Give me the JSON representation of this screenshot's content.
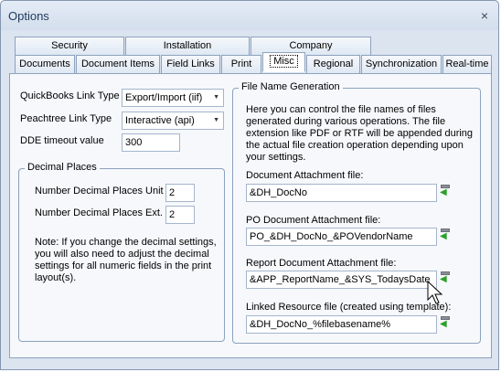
{
  "window": {
    "title": "Options",
    "close_glyph": "×"
  },
  "tabs_row1": [
    {
      "label": "Security"
    },
    {
      "label": "Installation"
    },
    {
      "label": "Company"
    }
  ],
  "tabs_row2": [
    {
      "label": "Documents"
    },
    {
      "label": "Document Items"
    },
    {
      "label": "Field Links"
    },
    {
      "label": "Print"
    },
    {
      "label": "Misc",
      "active": true
    },
    {
      "label": "Regional"
    },
    {
      "label": "Synchronization"
    },
    {
      "label": "Real-time"
    }
  ],
  "links": {
    "quickbooks_label": "QuickBooks Link Type",
    "quickbooks_value": "Export/Import (iif)",
    "peachtree_label": "Peachtree Link Type",
    "peachtree_value": "Interactive (api)",
    "dde_label": "DDE timeout value",
    "dde_value": "300"
  },
  "decimal": {
    "title": "Decimal Places",
    "unit_label": "Number Decimal Places Unit",
    "unit_value": "2",
    "ext_label": "Number Decimal Places Ext.",
    "ext_value": "2",
    "note_lines": [
      "Note: If you change the decimal settings,",
      "you will also need to adjust the decimal",
      "settings for all numeric fields in the print",
      "layout(s)."
    ]
  },
  "file_gen": {
    "title": "File Name Generation",
    "desc_lines": [
      "Here you can control the file names of files",
      "generated during various operations. The file",
      "extension like PDF or RTF will be appended during",
      "the actual file creation operation depending upon",
      "your settings."
    ],
    "doc_label": "Document Attachment file:",
    "doc_value": "&DH_DocNo",
    "po_label": "PO Document Attachment file:",
    "po_value": "PO_&DH_DocNo_&POVendorName",
    "report_label": "Report Document Attachment file:",
    "report_value": "&APP_ReportName_&SYS_TodaysDate",
    "linked_label": "Linked Resource file (created using template):",
    "linked_value": "&DH_DocNo_%filebasename%"
  },
  "colors": {
    "accent_green": "#2aa02a",
    "frame": "#8da2bd"
  }
}
